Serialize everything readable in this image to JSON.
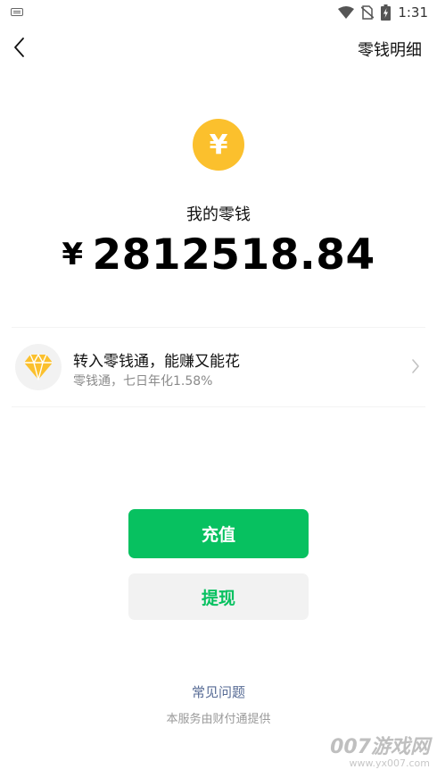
{
  "status_bar": {
    "time": "1:31",
    "icons": [
      "keyboard-icon",
      "wifi-icon",
      "no-sim-icon",
      "battery-charging-icon"
    ]
  },
  "header": {
    "back_icon": "chevron-left-icon",
    "detail_link": "零钱明细"
  },
  "balance": {
    "icon": "yen-coin-icon",
    "label": "我的零钱",
    "currency": "¥",
    "amount": "2812518.84"
  },
  "promo": {
    "icon": "diamond-icon",
    "title": "转入零钱通，能赚又能花",
    "subtitle": "零钱通，七日年化1.58%",
    "arrow_icon": "chevron-right-icon"
  },
  "actions": {
    "topup_label": "充值",
    "withdraw_label": "提现"
  },
  "footer": {
    "faq_label": "常见问题",
    "provider_text": "本服务由财付通提供"
  },
  "watermark": {
    "logo": "007游戏网",
    "url": "www.yx007.com"
  },
  "colors": {
    "accent_green": "#07c160",
    "coin_yellow": "#fbc02d",
    "link_blue": "#576b95"
  }
}
